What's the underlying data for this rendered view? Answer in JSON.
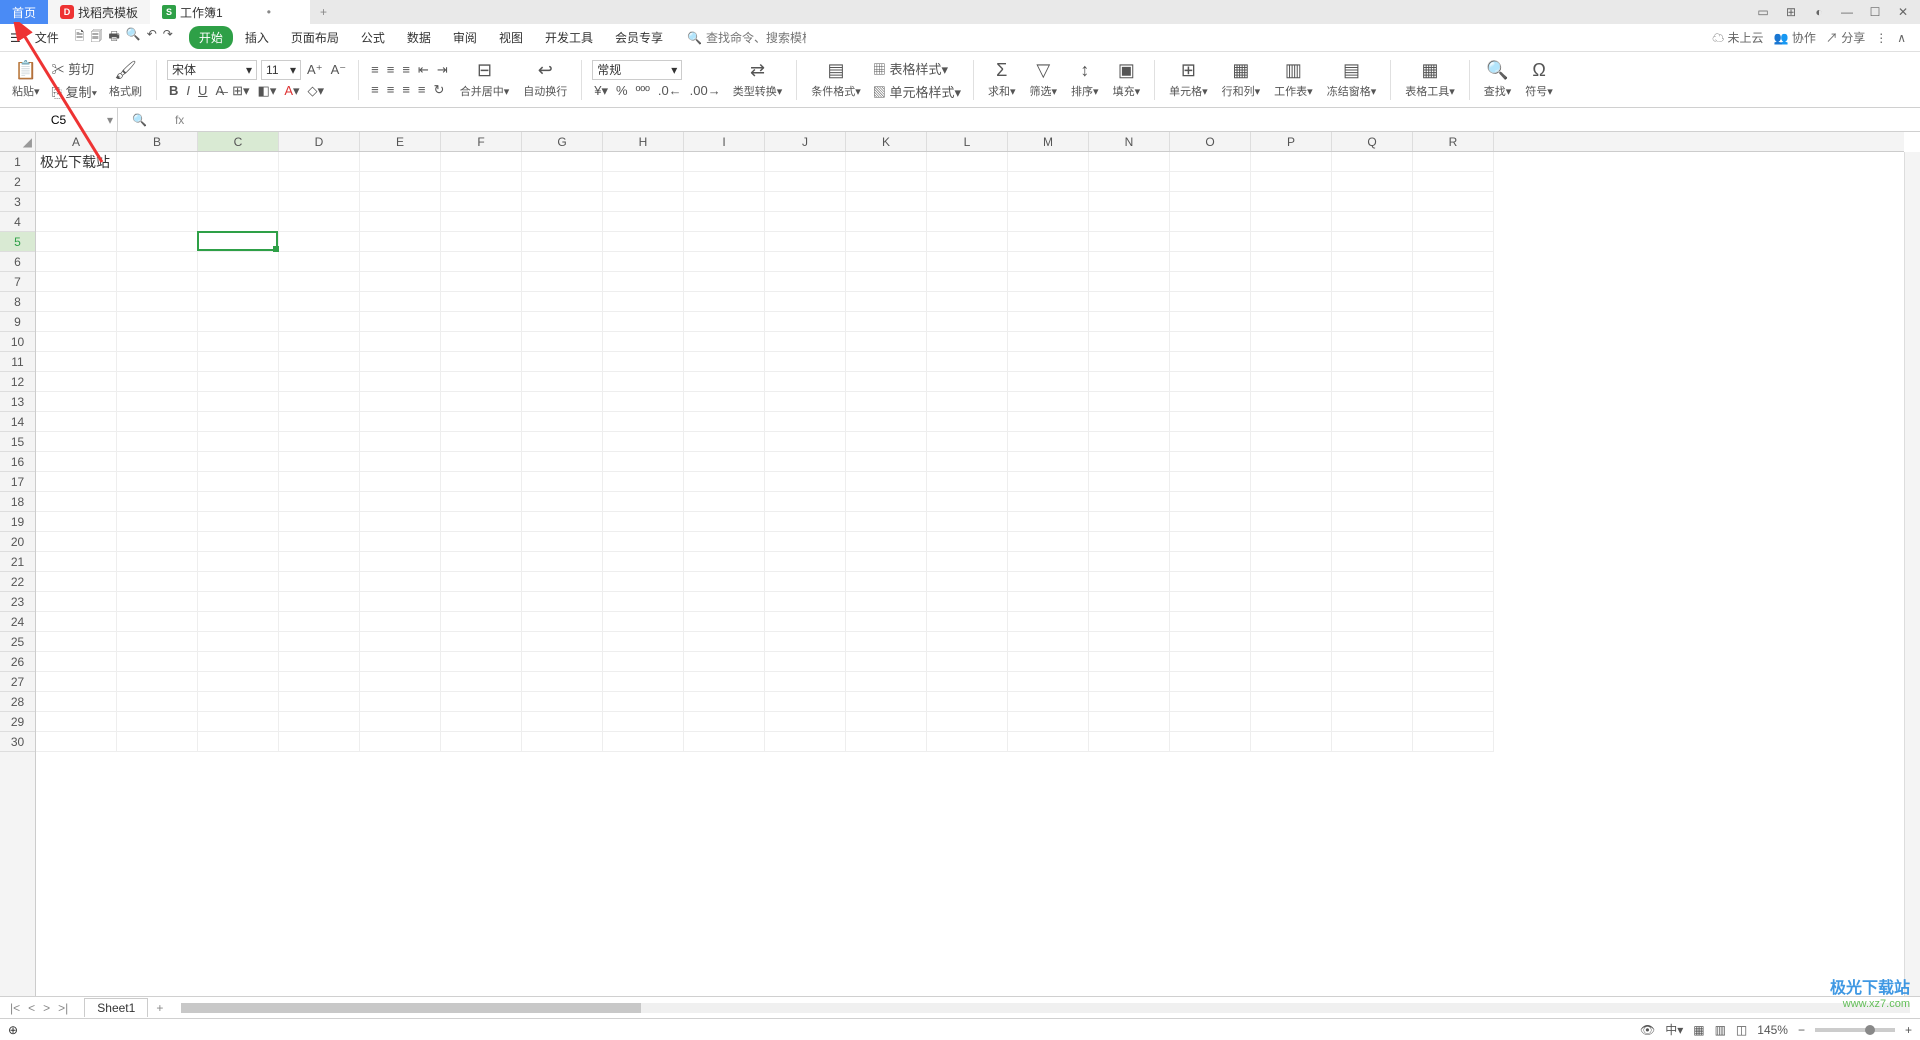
{
  "titlebar": {
    "home_tab": "首页",
    "template_tab": "找稻壳模板",
    "doc_tab": "工作簿1",
    "doc_dirty": "•",
    "add": "+"
  },
  "window_controls": {
    "min": "—",
    "max": "☐",
    "close": "✕"
  },
  "menubar": {
    "file": "文件",
    "tabs": [
      "开始",
      "插入",
      "页面布局",
      "公式",
      "数据",
      "审阅",
      "视图",
      "开发工具",
      "会员专享"
    ],
    "search_placeholder": "查找命令、搜索模板",
    "cloud": "未上云",
    "collab": "协作",
    "share": "分享"
  },
  "ribbon": {
    "paste": "粘贴",
    "cut": "剪切",
    "copy": "复制",
    "format_painter": "格式刷",
    "font_name": "宋体",
    "font_size": "11",
    "merge_center": "合并居中",
    "wrap": "自动换行",
    "number_format": "常规",
    "type_convert": "类型转换",
    "cond_format": "条件格式",
    "table_style": "表格样式",
    "cell_style": "单元格样式",
    "sum": "求和",
    "filter": "筛选",
    "sort": "排序",
    "fill": "填充",
    "cells": "单元格",
    "rows_cols": "行和列",
    "worksheet": "工作表",
    "freeze": "冻结窗格",
    "table_tools": "表格工具",
    "find": "查找",
    "symbol": "符号"
  },
  "fxbar": {
    "namebox": "C5",
    "fx": "fx"
  },
  "grid": {
    "columns": [
      "A",
      "B",
      "C",
      "D",
      "E",
      "F",
      "G",
      "H",
      "I",
      "J",
      "K",
      "L",
      "M",
      "N",
      "O",
      "P",
      "Q",
      "R"
    ],
    "row_count": 30,
    "selected_cell": "C5",
    "selected_col": "C",
    "selected_row": 5,
    "cells": {
      "A1": "极光下载站"
    }
  },
  "sheetbar": {
    "sheet1": "Sheet1",
    "add": "+"
  },
  "statusbar": {
    "zoom": "145%"
  },
  "watermark": {
    "line1": "极光下载站",
    "line2": "www.xz7.com"
  }
}
